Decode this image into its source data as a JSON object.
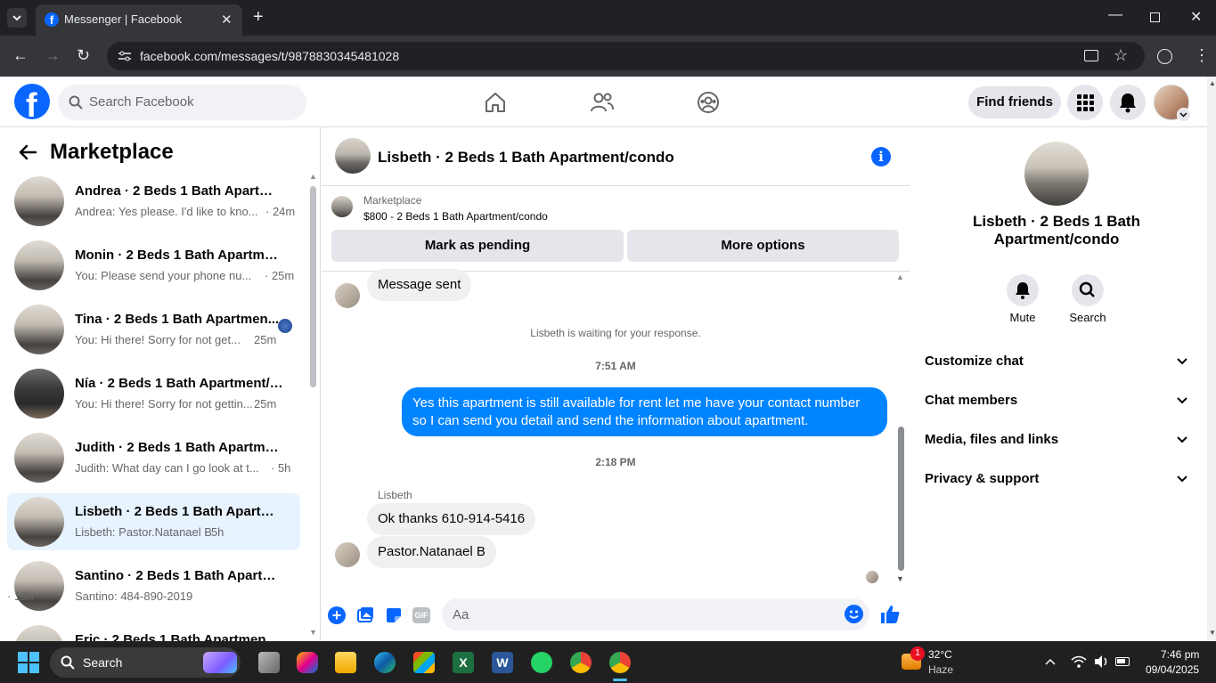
{
  "browser": {
    "tab_title": "Messenger | Facebook",
    "url": "facebook.com/messages/t/9878830345481028"
  },
  "fb": {
    "search_placeholder": "Search Facebook",
    "find_friends": "Find friends"
  },
  "sidebar": {
    "title": "Marketplace",
    "conversations": [
      {
        "name": "Andrea · 2 Beds 1 Bath Apartme...",
        "preview": "Andrea: Yes please. I'd like to kno...",
        "time": "· 24m"
      },
      {
        "name": "Monin · 2 Beds 1 Bath Apartmen...",
        "preview": "You: Please send your phone nu...",
        "time": "· 25m"
      },
      {
        "name": "Tina · 2 Beds 1 Bath Apartmen...",
        "preview": "You: Hi there! Sorry for not get...",
        "time": "25m"
      },
      {
        "name": "Nía · 2 Beds 1 Bath Apartment/c...",
        "preview": "You: Hi there! Sorry for not gettin...",
        "time": "25m"
      },
      {
        "name": "Judith · 2 Beds 1 Bath Apartmen...",
        "preview": "Judith: What day can I go look at t...",
        "time": "· 5h"
      },
      {
        "name": "Lisbeth · 2 Beds 1 Bath Apartme...",
        "preview": "Lisbeth: Pastor.Natanael B",
        "time": "· 5h"
      },
      {
        "name": "Santino · 2 Beds 1 Bath Apartme...",
        "preview": "Santino: 484-890-2019",
        "time": "· 10h"
      },
      {
        "name": "Eric · 2 Beds 1 Bath Apartment/c...",
        "preview": "",
        "time": ""
      }
    ]
  },
  "chat": {
    "header_name": "Lisbeth · 2 Beds 1 Bath Apartment/condo",
    "marketplace_label": "Marketplace",
    "listing": "$800 - 2 Beds 1 Bath Apartment/condo",
    "mark_pending": "Mark as pending",
    "more_options": "More options",
    "msg_sent": "Message sent",
    "waiting": "Lisbeth is waiting for your response.",
    "time1": "7:51 AM",
    "my_message": "Yes this apartment is still available for rent let me have your contact number so I can send you detail and send the information about apartment.",
    "time2": "2:18 PM",
    "sender": "Lisbeth",
    "reply1": "Ok thanks 610-914-5416",
    "reply2": "Pastor.Natanael B",
    "input_placeholder": "Aa"
  },
  "details": {
    "name": "Lisbeth · 2 Beds 1 Bath Apartment/condo",
    "mute": "Mute",
    "search": "Search",
    "sections": [
      "Customize chat",
      "Chat members",
      "Media, files and links",
      "Privacy & support"
    ]
  },
  "taskbar": {
    "search": "Search",
    "weather_temp": "32°C",
    "weather_desc": "Haze",
    "weather_badge": "1",
    "time": "7:46 pm",
    "date": "09/04/2025"
  },
  "colors": {
    "fb_blue": "#0866ff",
    "messenger_blue": "#0084ff",
    "selected_bg": "#e7f3ff"
  }
}
